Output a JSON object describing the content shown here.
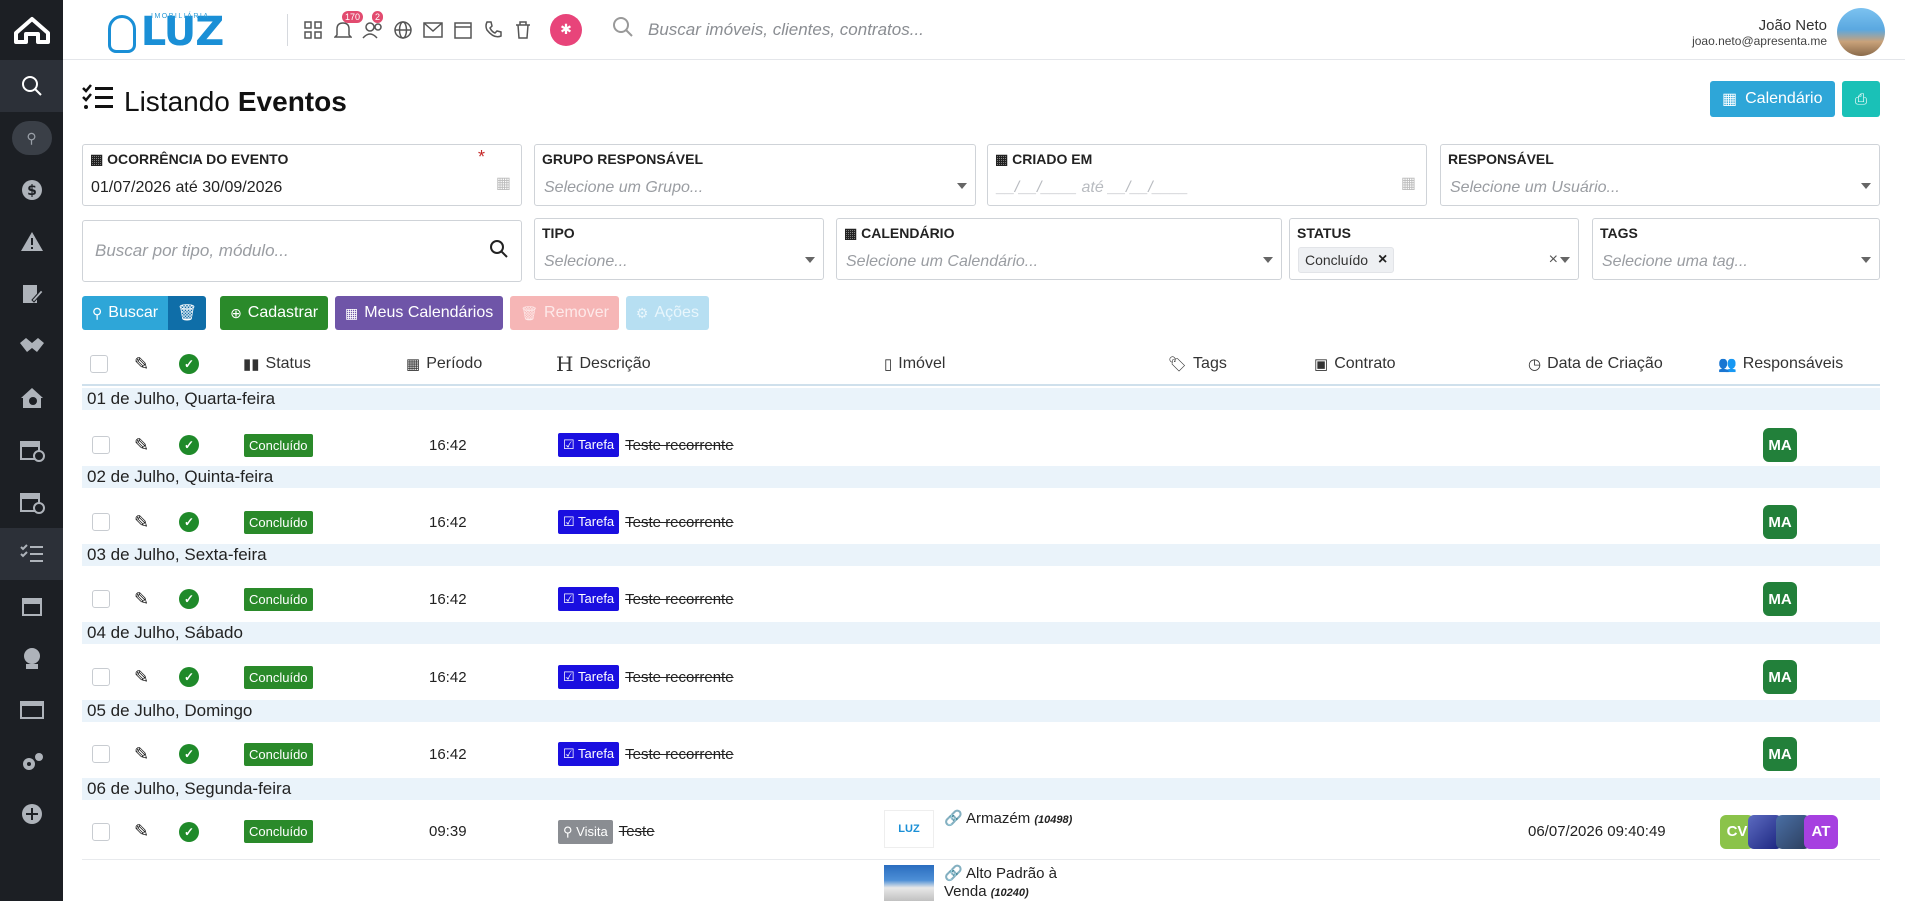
{
  "topbar": {
    "brand_small": "IMOBILIÁRIA",
    "brand_main": "LUZ",
    "badge_notifications": "170",
    "badge_users": "2",
    "search_placeholder": "Buscar imóveis, clientes, contratos...",
    "user_name": "João Neto",
    "user_email": "joao.neto@apresenta.me"
  },
  "page": {
    "title_light": "Listando",
    "title_bold": "Eventos",
    "btn_calendario": "Calendário"
  },
  "filters": {
    "ocorrencia_label": "OCORRÊNCIA DO EVENTO",
    "ocorrencia_value": "01/07/2026 até 30/09/2026",
    "grupo_label": "GRUPO RESPONSÁVEL",
    "grupo_ph": "Selecione um Grupo...",
    "criado_label": "CRIADO EM",
    "criado_ph": "__/__/____ até __/__/____",
    "responsavel_label": "RESPONSÁVEL",
    "responsavel_ph": "Selecione um Usuário...",
    "busca_ph": "Buscar por tipo, módulo...",
    "tipo_label": "TIPO",
    "tipo_ph": "Selecione...",
    "calendario_label": "CALENDÁRIO",
    "calendario_ph": "Selecione um Calendário...",
    "status_label": "STATUS",
    "status_chip": "Concluído",
    "tags_label": "TAGS",
    "tags_ph": "Selecione uma tag..."
  },
  "actions": {
    "buscar": "Buscar",
    "cadastrar": "Cadastrar",
    "meus_calendarios": "Meus Calendários",
    "remover": "Remover",
    "acoes": "Ações"
  },
  "table": {
    "headers": {
      "status": "Status",
      "periodo": "Período",
      "descricao": "Descrição",
      "imovel": "Imóvel",
      "tags": "Tags",
      "contrato": "Contrato",
      "data_criacao": "Data de Criação",
      "responsaveis": "Responsáveis"
    },
    "groups": [
      "01 de Julho, Quarta-feira",
      "02 de Julho, Quinta-feira",
      "03 de Julho, Sexta-feira",
      "04 de Julho, Sábado",
      "05 de Julho, Domingo",
      "06 de Julho, Segunda-feira"
    ],
    "rows": [
      {
        "status": "Concluído",
        "time": "16:42",
        "type": "Tarefa",
        "desc": "Teste recorrente",
        "resp": "MA"
      },
      {
        "status": "Concluído",
        "time": "16:42",
        "type": "Tarefa",
        "desc": "Teste recorrente",
        "resp": "MA"
      },
      {
        "status": "Concluído",
        "time": "16:42",
        "type": "Tarefa",
        "desc": "Teste recorrente",
        "resp": "MA"
      },
      {
        "status": "Concluído",
        "time": "16:42",
        "type": "Tarefa",
        "desc": "Teste recorrente",
        "resp": "MA"
      },
      {
        "status": "Concluído",
        "time": "16:42",
        "type": "Tarefa",
        "desc": "Teste recorrente",
        "resp": "MA"
      },
      {
        "status": "Concluído",
        "time": "09:39",
        "type": "Visita",
        "desc": "Teste",
        "imovel1": "Armazém",
        "imovel1_code": "(10498)",
        "imovel2_a": "Alto Padrão à",
        "imovel2_b": "Venda",
        "imovel2_code": "(10240)",
        "thumb_text": "LUZ",
        "created": "06/07/2026 09:40:49",
        "resp_cv": "CV",
        "resp_at": "AT"
      }
    ]
  }
}
